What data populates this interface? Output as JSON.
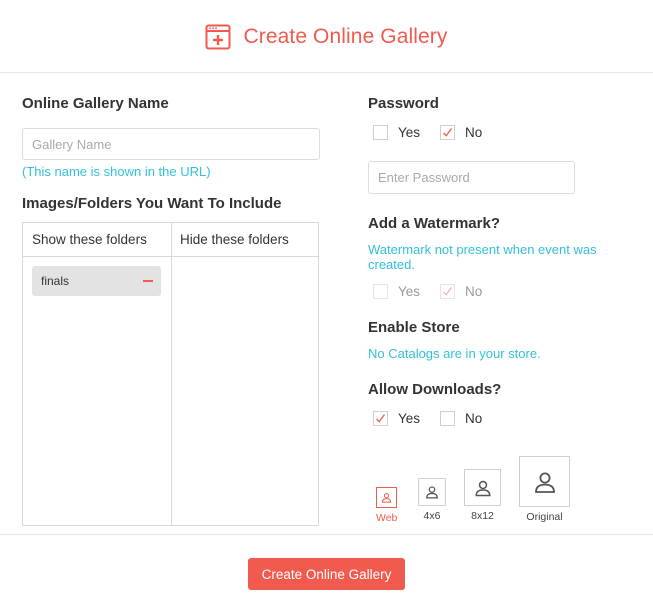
{
  "header": {
    "title": "Create Online Gallery",
    "icon": "gallery-add-icon",
    "accent": "#f05a4f"
  },
  "gallery_name": {
    "title": "Online Gallery Name",
    "placeholder": "Gallery Name",
    "value": "",
    "hint": "(This name is shown in the URL)"
  },
  "folders": {
    "title": "Images/Folders You Want To Include",
    "show_header": "Show these folders",
    "hide_header": "Hide these folders",
    "shown": [
      {
        "name": "finals"
      }
    ],
    "hidden": []
  },
  "password": {
    "title": "Password",
    "yes_label": "Yes",
    "no_label": "No",
    "yes_checked": false,
    "no_checked": true,
    "placeholder": "Enter Password",
    "value": ""
  },
  "watermark": {
    "title": "Add a Watermark?",
    "note": "Watermark not present when event was created.",
    "yes_label": "Yes",
    "no_label": "No",
    "yes_checked": false,
    "no_checked": true,
    "disabled": true
  },
  "store": {
    "title": "Enable Store",
    "note": "No Catalogs are in your store."
  },
  "downloads": {
    "title": "Allow Downloads?",
    "yes_label": "Yes",
    "no_label": "No",
    "yes_checked": true,
    "no_checked": false,
    "sizes": [
      {
        "label": "Web",
        "selected": true
      },
      {
        "label": "4x6",
        "selected": false
      },
      {
        "label": "8x12",
        "selected": false
      },
      {
        "label": "Original",
        "selected": false
      }
    ]
  },
  "footer": {
    "submit_label": "Create Online Gallery"
  },
  "colors": {
    "accent": "#f05a4f",
    "hint": "#33c1d9",
    "text": "#333333",
    "border": "#d9d9d9"
  }
}
